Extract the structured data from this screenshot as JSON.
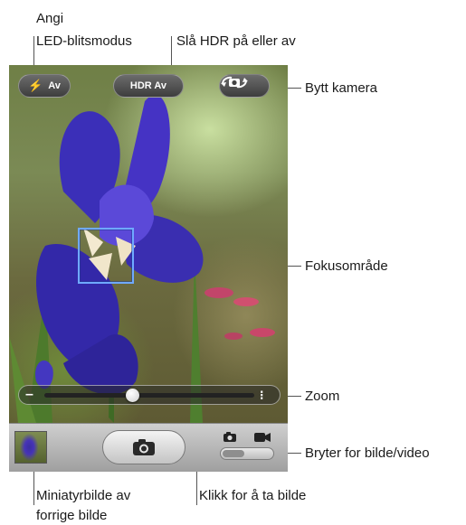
{
  "callouts": {
    "flash_line1": "Angi",
    "flash_line2": "LED-blitsmodus",
    "hdr": "Slå HDR på eller av",
    "switch_camera": "Bytt kamera",
    "focus": "Fokusområde",
    "zoom": "Zoom",
    "photo_video": "Bryter for bilde/video",
    "thumbnail_line1": "Miniatyrbilde av",
    "thumbnail_line2": "forrige bilde",
    "shutter": "Klikk for å ta bilde"
  },
  "camera": {
    "flash_label": "Av",
    "hdr_label": "HDR Av",
    "mode_selected": "photo",
    "zoom_level": 0.42
  },
  "colors": {
    "focus_box": "#6fa9ff",
    "iris": "#3b2fb8"
  },
  "icons": {
    "flash": "lightning-bolt-icon",
    "switch_camera": "camera-rotate-icon",
    "shutter": "camera-icon",
    "photo_mode": "camera-icon",
    "video_mode": "video-camera-icon"
  }
}
